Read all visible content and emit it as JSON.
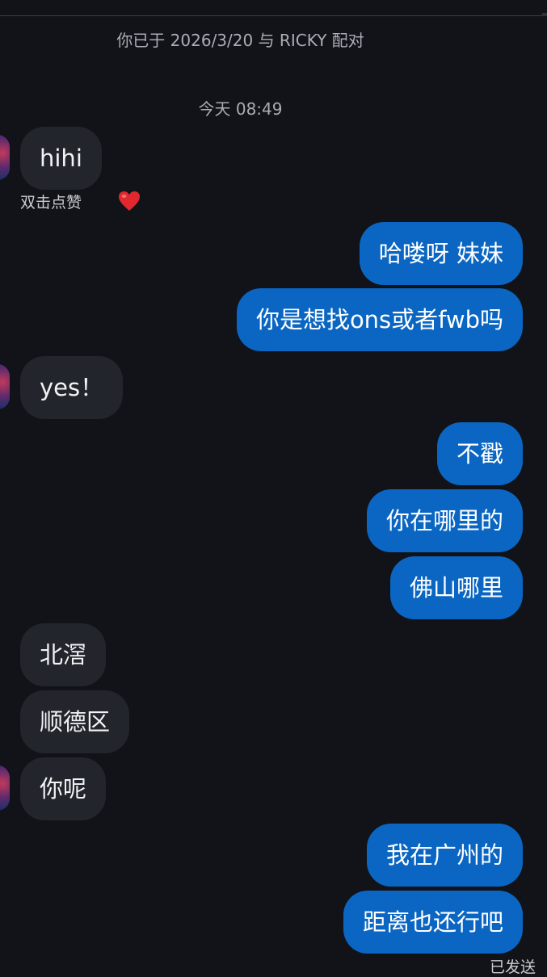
{
  "header": {
    "matched_text": "你已于 2026/3/20 与 RICKY 配对",
    "timestamp": "今天 08:49"
  },
  "messages": [
    {
      "side": "in",
      "text": "hihi"
    },
    {
      "side": "out",
      "text": "哈喽呀 妹妹"
    },
    {
      "side": "out",
      "text": "你是想找ons或者fwb吗"
    },
    {
      "side": "in",
      "text": "yes！"
    },
    {
      "side": "out",
      "text": "不戳"
    },
    {
      "side": "out",
      "text": "你在哪里的"
    },
    {
      "side": "out",
      "text": "佛山哪里"
    },
    {
      "side": "in",
      "text": "北滘"
    },
    {
      "side": "in",
      "text": "顺德区"
    },
    {
      "side": "in",
      "text": "你呢"
    },
    {
      "side": "out",
      "text": "我在广州的"
    },
    {
      "side": "out",
      "text": "距离也还行吧"
    }
  ],
  "reaction": {
    "hint": "双击点赞",
    "icon": "heart-icon",
    "color": "#e0282e"
  },
  "delivery_status": "已发送",
  "colors": {
    "background": "#111318",
    "incoming_bubble": "#23252c",
    "outgoing_bubble": "#0a66c2"
  }
}
